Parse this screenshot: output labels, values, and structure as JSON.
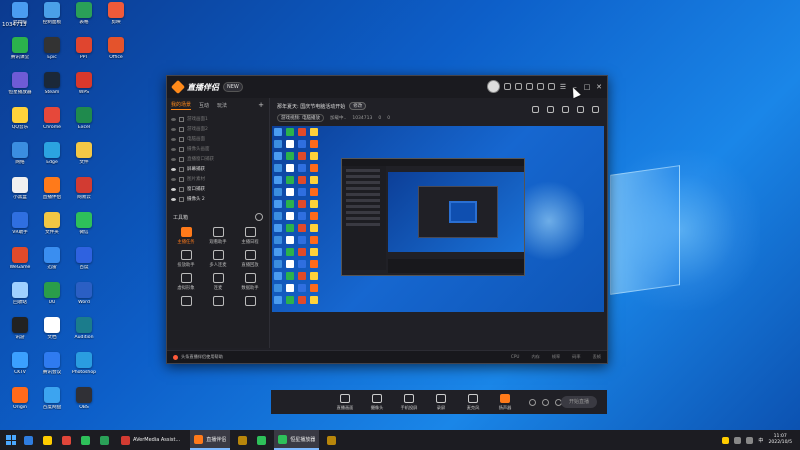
{
  "desktop": {
    "counter": "1034713",
    "icons": [
      {
        "label": "此电脑",
        "color": "#4a9cf0"
      },
      {
        "label": "腾讯课堂",
        "color": "#2bb24c"
      },
      {
        "label": "恒星播放器",
        "color": "#6f5bd6"
      },
      {
        "label": "QQ音乐",
        "color": "#ffd23a"
      },
      {
        "label": "网络",
        "color": "#3b8ee0"
      },
      {
        "label": "小黑盒",
        "color": "#f0f0f0"
      },
      {
        "label": "VR助手",
        "color": "#2f6fe0"
      },
      {
        "label": "WeGame",
        "color": "#e04a2a"
      },
      {
        "label": "回收站",
        "color": "#9fd0ff"
      },
      {
        "label": "讯游",
        "color": "#222222"
      },
      {
        "label": "CKTV",
        "color": "#3ba0ff"
      },
      {
        "label": "Origin",
        "color": "#ff6a1a"
      },
      {
        "label": "控制面板",
        "color": "#4aa0e8"
      },
      {
        "label": "Epic",
        "color": "#333333"
      },
      {
        "label": "Steam",
        "color": "#1b2838"
      },
      {
        "label": "Chrome",
        "color": "#e6483a"
      },
      {
        "label": "Edge",
        "color": "#2ba3e0"
      },
      {
        "label": "直播伴侣",
        "color": "#ff7a1a"
      },
      {
        "label": "文件夹",
        "color": "#f2c744"
      },
      {
        "label": "迅雷",
        "color": "#3a8ef0"
      },
      {
        "label": "UU",
        "color": "#2a9d4a"
      },
      {
        "label": "文档",
        "color": "#ffffff"
      },
      {
        "label": "腾讯会议",
        "color": "#2f7bf0"
      },
      {
        "label": "百度网盘",
        "color": "#3ca4f0"
      },
      {
        "label": "表格",
        "color": "#2aa058"
      },
      {
        "label": "PPT",
        "color": "#e0452f"
      },
      {
        "label": "WPS",
        "color": "#d9382b"
      },
      {
        "label": "Excel",
        "color": "#1f8a4d"
      },
      {
        "label": "文件",
        "color": "#f3c846"
      },
      {
        "label": "网易云",
        "color": "#d23b32"
      },
      {
        "label": "微信",
        "color": "#2ec05a"
      },
      {
        "label": "百度",
        "color": "#2f62e0"
      },
      {
        "label": "Word",
        "color": "#2b5fc4"
      },
      {
        "label": "Audition",
        "color": "#1b7c8c"
      },
      {
        "label": "Photoshop",
        "color": "#2a9de0"
      },
      {
        "label": "OBS",
        "color": "#303036"
      },
      {
        "label": "剪映",
        "color": "#f05a3a"
      },
      {
        "label": "Office",
        "color": "#e4532c"
      }
    ]
  },
  "app": {
    "title": "直播伴侣",
    "version": "NEW",
    "tabs": [
      "我的场景",
      "互动",
      "玩法"
    ],
    "scenes": [
      {
        "label": "游戏画面1",
        "bright": false
      },
      {
        "label": "游戏画面2",
        "bright": false
      },
      {
        "label": "电脑画面",
        "bright": false
      },
      {
        "label": "摄像头画面",
        "bright": false
      },
      {
        "label": "直播窗口捕获",
        "bright": false
      },
      {
        "label": "屏幕捕获",
        "bright": true
      },
      {
        "label": "图片素材",
        "bright": false
      },
      {
        "label": "窗口捕获",
        "bright": true
      },
      {
        "label": "摄像头 2",
        "bright": true
      }
    ],
    "toolbox_label": "工具箱",
    "tools": [
      {
        "label": "主播任务",
        "hot": true
      },
      {
        "label": "观看助手",
        "hot": false
      },
      {
        "label": "主播日程",
        "hot": false
      },
      {
        "label": "投放助手",
        "hot": false
      },
      {
        "label": "多人连麦",
        "hot": false
      },
      {
        "label": "直播回放",
        "hot": false
      },
      {
        "label": "虚拟形象",
        "hot": false
      },
      {
        "label": "连麦",
        "hot": false
      },
      {
        "label": "数据助手",
        "hot": false
      },
      {
        "label": "",
        "hot": false
      },
      {
        "label": "",
        "hot": false
      },
      {
        "label": "",
        "hot": false
      }
    ],
    "room_title": "那年夏天: 国庆节电脑活动开始",
    "edit_label": "修改",
    "meta_tag": "游戏视频: 电脑播放",
    "meta_stats": [
      "加载中..",
      "1034713",
      "0",
      "0"
    ],
    "controls": [
      "直播画面",
      "摄像头",
      "手机投屏",
      "录屏",
      "麦克风",
      "扬声器"
    ],
    "go_live": "开始直播",
    "status_message": "头条直播伴侣使用帮助",
    "status_stats": [
      "CPU",
      "内存",
      "帧率",
      "码率",
      "丢帧"
    ]
  },
  "taskbar": {
    "items": [
      {
        "label": "",
        "color": "#2f7de0",
        "active": false
      },
      {
        "label": "",
        "color": "#ffcc00",
        "active": false
      },
      {
        "label": "",
        "color": "#e0463a",
        "active": false
      },
      {
        "label": "",
        "color": "#2ec05a",
        "active": false
      },
      {
        "label": "",
        "color": "#2aa058",
        "active": false
      },
      {
        "label": "AVerMedia Assist...",
        "color": "#d23b32",
        "active": false
      },
      {
        "label": "直播伴侣",
        "color": "#ff7a1a",
        "active": true
      },
      {
        "label": "",
        "color": "#b8860b",
        "active": false
      },
      {
        "label": "",
        "color": "#2ec05a",
        "active": false
      },
      {
        "label": "恒星播放器",
        "color": "#2ec05a",
        "active": true
      },
      {
        "label": "",
        "color": "#b8860b",
        "active": false
      }
    ],
    "time": "11:07",
    "date": "2022/10/5",
    "lang": "中"
  }
}
